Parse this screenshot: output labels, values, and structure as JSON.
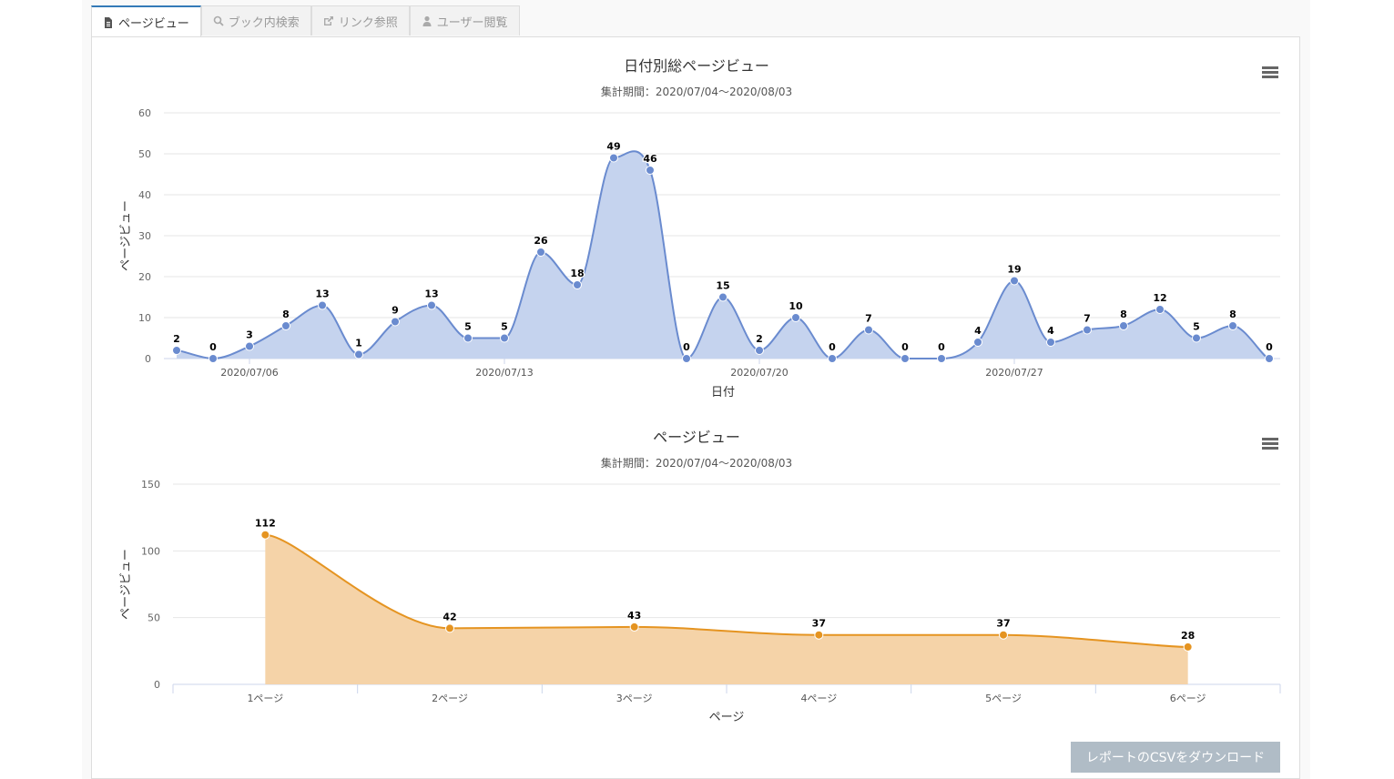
{
  "tabs": [
    {
      "label": "ページビュー",
      "icon": "file-icon",
      "active": true
    },
    {
      "label": "ブック内検索",
      "icon": "search-icon",
      "active": false
    },
    {
      "label": "リンク参照",
      "icon": "external-link-icon",
      "active": false
    },
    {
      "label": "ユーザー閲覧",
      "icon": "user-icon",
      "active": false
    }
  ],
  "csv_button_label": "レポートのCSVをダウンロード",
  "colors": {
    "series1": "#6a8bcf",
    "series1_fill": "#c5d3ee",
    "series2": "#e59421",
    "series2_fill": "#f5d3a8"
  },
  "chart_data": [
    {
      "type": "area",
      "title": "日付別総ページビュー",
      "subtitle": "集計期間：2020/07/04～2020/08/03",
      "xlabel": "日付",
      "ylabel": "ページビュー",
      "ylim": [
        0,
        60
      ],
      "yticks": [
        0,
        10,
        20,
        30,
        40,
        50,
        60
      ],
      "grid": true,
      "x": [
        "2020/07/04",
        "2020/07/05",
        "2020/07/06",
        "2020/07/07",
        "2020/07/08",
        "2020/07/09",
        "2020/07/10",
        "2020/07/11",
        "2020/07/12",
        "2020/07/13",
        "2020/07/14",
        "2020/07/15",
        "2020/07/16",
        "2020/07/17",
        "2020/07/18",
        "2020/07/19",
        "2020/07/20",
        "2020/07/21",
        "2020/07/22",
        "2020/07/23",
        "2020/07/24",
        "2020/07/25",
        "2020/07/26",
        "2020/07/27",
        "2020/07/28",
        "2020/07/29",
        "2020/07/30",
        "2020/07/31",
        "2020/08/01",
        "2020/08/02",
        "2020/08/03"
      ],
      "xtick_labels": [
        "2020/07/06",
        "2020/07/13",
        "2020/07/20",
        "2020/07/27"
      ],
      "values": [
        2,
        0,
        3,
        8,
        13,
        1,
        9,
        13,
        5,
        5,
        26,
        18,
        49,
        46,
        0,
        15,
        2,
        10,
        0,
        7,
        0,
        0,
        4,
        19,
        4,
        7,
        8,
        12,
        5,
        8,
        0
      ]
    },
    {
      "type": "area",
      "title": "ページビュー",
      "subtitle": "集計期間：2020/07/04～2020/08/03",
      "xlabel": "ページ",
      "ylabel": "ページビュー",
      "ylim": [
        0,
        150
      ],
      "yticks": [
        0,
        50,
        100,
        150
      ],
      "grid": true,
      "categories": [
        "1ページ",
        "2ページ",
        "3ページ",
        "4ページ",
        "5ページ",
        "6ページ"
      ],
      "values": [
        112,
        42,
        43,
        37,
        37,
        28
      ]
    }
  ]
}
